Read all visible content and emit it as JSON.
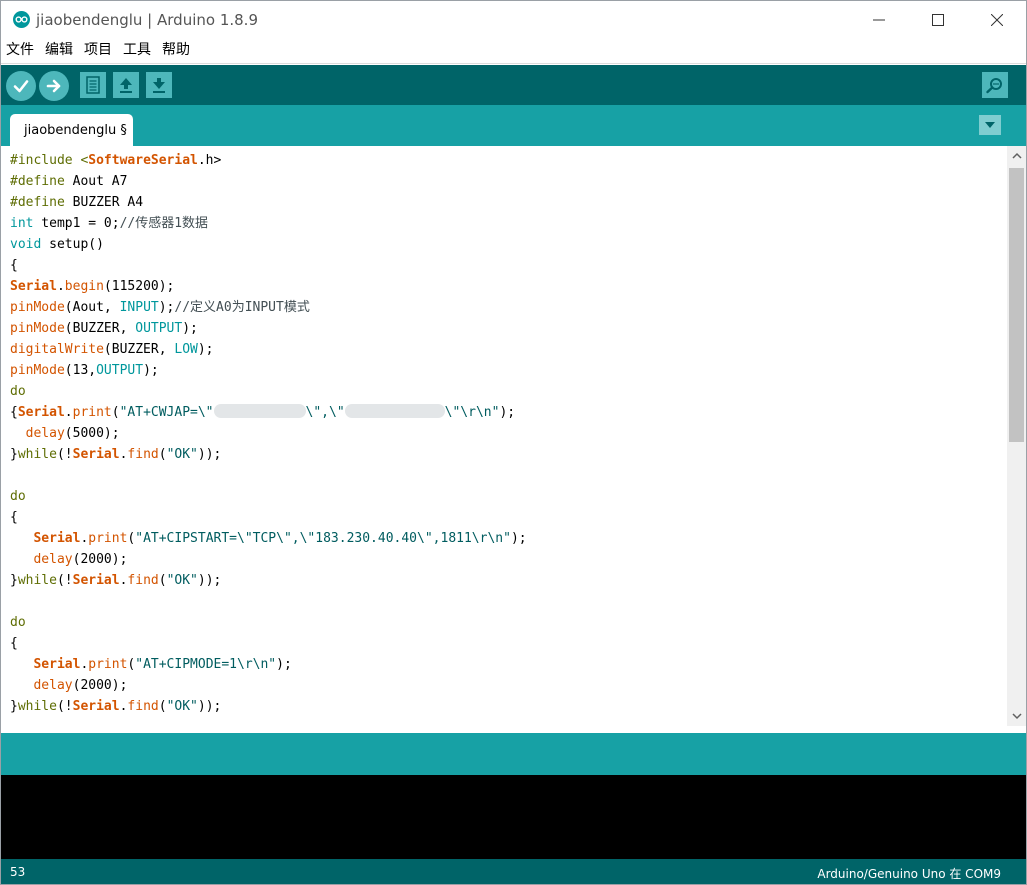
{
  "window": {
    "title": "jiaobendenglu | Arduino 1.8.9"
  },
  "menu": [
    "文件",
    "编辑",
    "项目",
    "工具",
    "帮助"
  ],
  "toolbar": {
    "verify": "check-icon",
    "upload": "arrow-right-icon",
    "new": "document-icon",
    "open": "arrow-up-icon",
    "save": "arrow-down-icon",
    "serial_monitor": "magnifier-icon"
  },
  "tab": {
    "label": "jiaobendenglu §"
  },
  "code": {
    "l1_a": "#include <",
    "l1_b": "SoftwareSerial",
    "l1_c": ".h>",
    "l2_a": "#define",
    "l2_b": " Aout A7",
    "l3_a": "#define",
    "l3_b": " BUZZER A4",
    "l4_a": "int",
    "l4_b": " temp1 = 0;",
    "l4_c": "//传感器1数据",
    "l5_a": "void",
    "l5_b": " setup()",
    "l6": "{",
    "l7_a": "Serial",
    "l7_b": ".",
    "l7_c": "begin",
    "l7_d": "(115200);",
    "l8_a": "pinMode",
    "l8_b": "(Aout, ",
    "l8_c": "INPUT",
    "l8_d": ");",
    "l8_e": "//定义A0为INPUT模式",
    "l9_a": "pinMode",
    "l9_b": "(BUZZER, ",
    "l9_c": "OUTPUT",
    "l9_d": ");",
    "l10_a": "digitalWrite",
    "l10_b": "(BUZZER, ",
    "l10_c": "LOW",
    "l10_d": ");",
    "l11_a": "pinMode",
    "l11_b": "(13,",
    "l11_c": "OUTPUT",
    "l11_d": ");",
    "l12": "do",
    "l13_a": "{",
    "l13_b": "Serial",
    "l13_c": ".",
    "l13_d": "print",
    "l13_e": "(",
    "l13_f": "\"AT+CWJAP=\\\"",
    "l13_g": "\\\",\\\"",
    "l13_h": "\\\"\\r\\n\"",
    "l13_i": ");",
    "l14_a": "  ",
    "l14_b": "delay",
    "l14_c": "(5000);",
    "l15_a": "}",
    "l15_b": "while",
    "l15_c": "(!",
    "l15_d": "Serial",
    "l15_e": ".",
    "l15_f": "find",
    "l15_g": "(",
    "l15_h": "\"OK\"",
    "l15_i": "));",
    "l16": "",
    "l17": "do",
    "l18": "{",
    "l19_a": "   ",
    "l19_b": "Serial",
    "l19_c": ".",
    "l19_d": "print",
    "l19_e": "(",
    "l19_f": "\"AT+CIPSTART=\\\"TCP\\\",\\\"183.230.40.40\\\",1811\\r\\n\"",
    "l19_g": ");",
    "l20_a": "   ",
    "l20_b": "delay",
    "l20_c": "(2000);",
    "l21_a": "}",
    "l21_b": "while",
    "l21_c": "(!",
    "l21_d": "Serial",
    "l21_e": ".",
    "l21_f": "find",
    "l21_g": "(",
    "l21_h": "\"OK\"",
    "l21_i": "));",
    "l22": "",
    "l23": "do",
    "l24": "{",
    "l25_a": "   ",
    "l25_b": "Serial",
    "l25_c": ".",
    "l25_d": "print",
    "l25_e": "(",
    "l25_f": "\"AT+CIPMODE=1\\r\\n\"",
    "l25_g": ");",
    "l26_a": "   ",
    "l26_b": "delay",
    "l26_c": "(2000);",
    "l27_a": "}",
    "l27_b": "while",
    "l27_c": "(!",
    "l27_d": "Serial",
    "l27_e": ".",
    "l27_f": "find",
    "l27_g": "(",
    "l27_h": "\"OK\"",
    "l27_i": "));"
  },
  "status": {
    "line": "53",
    "board": "Arduino/Genuino Uno 在 COM9"
  },
  "colors": {
    "toolbar": "#006468",
    "tabbar": "#17a1a5",
    "button": "#4db7bb",
    "keyword_orange": "#d35400",
    "keyword_teal": "#00979c",
    "preprocessor": "#5e6d03",
    "string": "#005c5f"
  }
}
